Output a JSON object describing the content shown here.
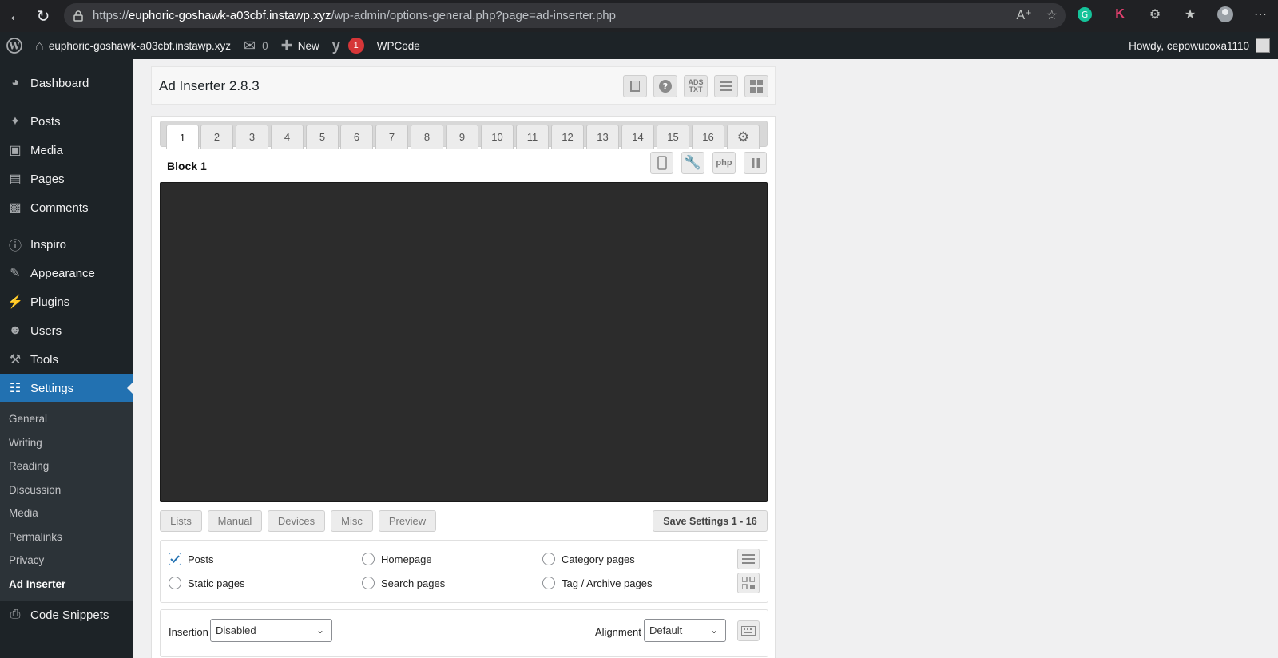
{
  "browser": {
    "url_scheme": "https://",
    "url_host": "euphoric-goshawk-a03cbf.instawp.xyz",
    "url_path": "/wp-admin/options-general.php?page=ad-inserter.php"
  },
  "adminbar": {
    "site_name": "euphoric-goshawk-a03cbf.instawp.xyz",
    "comments_count": "0",
    "new_label": "New",
    "yoast_badge": "1",
    "wpcode_label": "WPCode",
    "howdy": "Howdy, cepowucoxa1110"
  },
  "sidebar": {
    "items": [
      {
        "label": "Dashboard",
        "icon": "dashboard-icon"
      },
      {
        "label": "Posts",
        "icon": "pin-icon"
      },
      {
        "label": "Media",
        "icon": "media-icon"
      },
      {
        "label": "Pages",
        "icon": "pages-icon"
      },
      {
        "label": "Comments",
        "icon": "comment-icon"
      },
      {
        "label": "Inspiro",
        "icon": "info-icon"
      },
      {
        "label": "Appearance",
        "icon": "brush-icon"
      },
      {
        "label": "Plugins",
        "icon": "plugin-icon"
      },
      {
        "label": "Users",
        "icon": "user-icon"
      },
      {
        "label": "Tools",
        "icon": "wrench-icon"
      },
      {
        "label": "Settings",
        "icon": "settings-icon"
      }
    ],
    "submenu": [
      "General",
      "Writing",
      "Reading",
      "Discussion",
      "Media",
      "Permalinks",
      "Privacy",
      "Ad Inserter"
    ],
    "after": [
      {
        "label": "Code Snippets",
        "icon": "code-icon"
      }
    ]
  },
  "plugin": {
    "title": "Ad Inserter 2.8.3",
    "header_icons": [
      "book-icon",
      "help-icon",
      "ads-txt-icon",
      "list-icon",
      "grid-icon"
    ],
    "ads_txt_label": "ADS TXT"
  },
  "tabs": [
    "1",
    "2",
    "3",
    "4",
    "5",
    "6",
    "7",
    "8",
    "9",
    "10",
    "11",
    "12",
    "13",
    "14",
    "15",
    "16"
  ],
  "block": {
    "title": "Block 1",
    "php_label": "php"
  },
  "options": [
    "Lists",
    "Manual",
    "Devices",
    "Misc",
    "Preview"
  ],
  "save_label": "Save Settings 1 - 16",
  "checkboxes": {
    "posts": {
      "label": "Posts",
      "checked": true
    },
    "homepage": {
      "label": "Homepage",
      "checked": false
    },
    "category": {
      "label": "Category pages",
      "checked": false
    },
    "static": {
      "label": "Static pages",
      "checked": false
    },
    "search": {
      "label": "Search pages",
      "checked": false
    },
    "tag": {
      "label": "Tag / Archive pages",
      "checked": false
    }
  },
  "insertion": {
    "label": "Insertion",
    "value": "Disabled",
    "alignment_label": "Alignment",
    "alignment_value": "Default"
  },
  "colors": {
    "accent": "#2271b1",
    "adminbar": "#1d2327",
    "editor_bg": "#2c2c2c"
  }
}
